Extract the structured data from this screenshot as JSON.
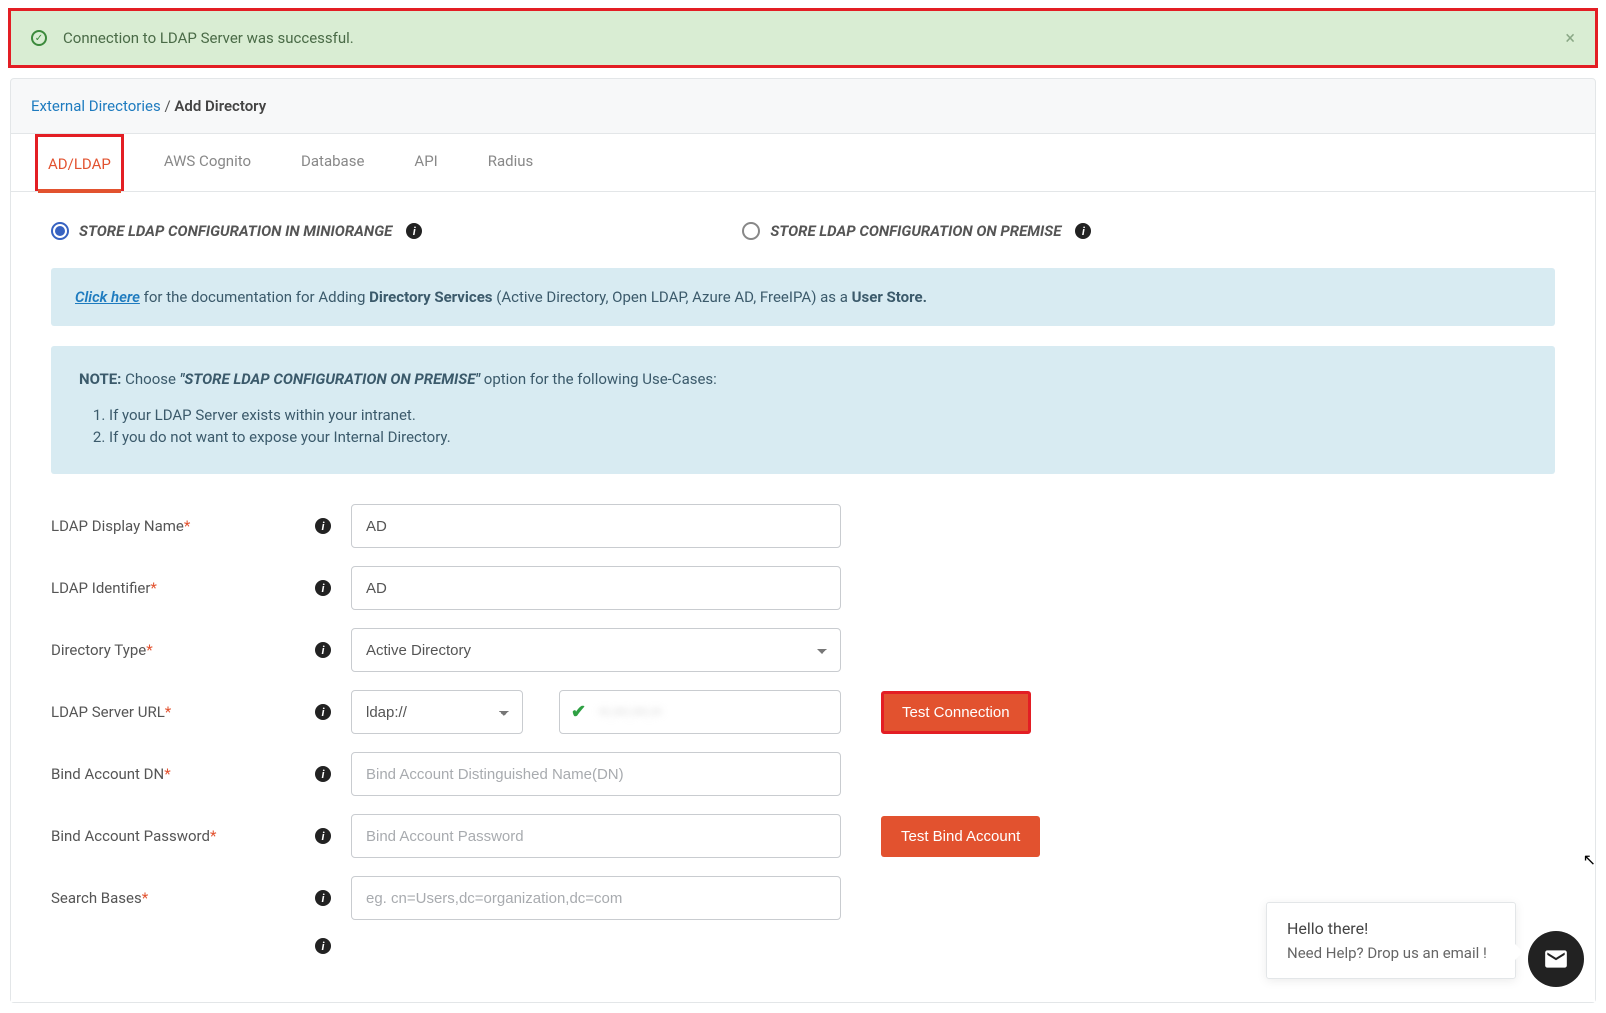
{
  "alert": {
    "message": "Connection to LDAP Server was successful.",
    "close_label": "×"
  },
  "breadcrumb": {
    "parent": "External Directories",
    "separator": "/",
    "current": "Add Directory"
  },
  "tabs": {
    "items": [
      "AD/LDAP",
      "AWS Cognito",
      "Database",
      "API",
      "Radius"
    ],
    "active_index": 0
  },
  "config_location": {
    "option_miniorange": "STORE LDAP CONFIGURATION IN MINIORANGE",
    "option_onpremise": "STORE LDAP CONFIGURATION ON PREMISE",
    "selected": "miniorange"
  },
  "doc_banner": {
    "link_text": "Click here",
    "mid1": " for the documentation for Adding ",
    "bold1": "Directory Services",
    "mid2": " (Active Directory, Open LDAP, Azure AD, FreeIPA) as a ",
    "bold2": "User Store."
  },
  "note_banner": {
    "label": "NOTE:",
    "pre": "  Choose ",
    "emph": "\"STORE LDAP CONFIGURATION ON PREMISE\"",
    "post": " option for the following Use-Cases:",
    "items": [
      "If your LDAP Server exists within your intranet.",
      "If you do not want to expose your Internal Directory."
    ]
  },
  "form": {
    "display_name": {
      "label": "LDAP Display Name",
      "value": "AD"
    },
    "identifier": {
      "label": "LDAP Identifier",
      "value": "AD"
    },
    "directory_type": {
      "label": "Directory Type",
      "value": "Active Directory"
    },
    "server_url": {
      "label": "LDAP Server URL",
      "scheme": "ldap://",
      "host_blurred": "••.•••.•••.••",
      "test_btn": "Test Connection"
    },
    "bind_dn": {
      "label": "Bind Account DN",
      "placeholder": "Bind Account Distinguished Name(DN)"
    },
    "bind_pw": {
      "label": "Bind Account Password",
      "placeholder": "Bind Account Password",
      "test_btn": "Test Bind Account"
    },
    "search_bases": {
      "label": "Search Bases",
      "placeholder": "eg. cn=Users,dc=organization,dc=com"
    }
  },
  "chat": {
    "line1": "Hello there!",
    "line2": "Need Help? Drop us an email !"
  }
}
